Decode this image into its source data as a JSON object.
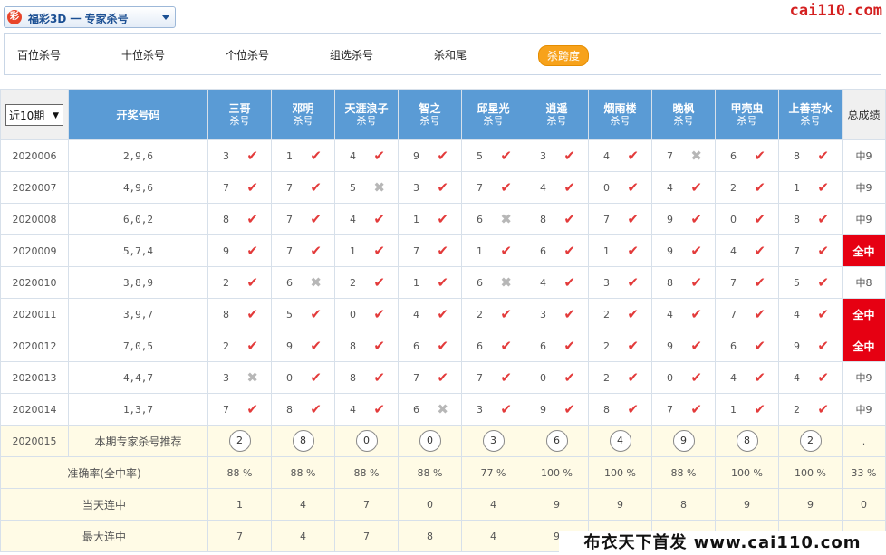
{
  "selector": {
    "logo": "彩",
    "label": "福彩3D 一 专家杀号"
  },
  "site": "cai110.com",
  "tabs": [
    {
      "label": "百位杀号",
      "active": false
    },
    {
      "label": "十位杀号",
      "active": false
    },
    {
      "label": "个位杀号",
      "active": false
    },
    {
      "label": "组选杀号",
      "active": false
    },
    {
      "label": "杀和尾",
      "active": false
    },
    {
      "label": "杀跨度",
      "active": true
    }
  ],
  "table": {
    "filter": "近10期",
    "draw_header": "开奖号码",
    "sub_header": "杀号",
    "score_header": "总成绩",
    "experts": [
      "三哥",
      "邓明",
      "天涯浪子",
      "智之",
      "邱星光",
      "逍遥",
      "烟雨楼",
      "晚枫",
      "甲壳虫",
      "上善若水"
    ],
    "rows": [
      {
        "period": "2020006",
        "draw": "2,9,6",
        "cells": [
          [
            "3",
            true
          ],
          [
            "1",
            true
          ],
          [
            "4",
            true
          ],
          [
            "9",
            true
          ],
          [
            "5",
            true
          ],
          [
            "3",
            true
          ],
          [
            "4",
            true
          ],
          [
            "7",
            false
          ],
          [
            "6",
            true
          ],
          [
            "8",
            true
          ]
        ],
        "score": "中9",
        "full": false
      },
      {
        "period": "2020007",
        "draw": "4,9,6",
        "cells": [
          [
            "7",
            true
          ],
          [
            "7",
            true
          ],
          [
            "5",
            false
          ],
          [
            "3",
            true
          ],
          [
            "7",
            true
          ],
          [
            "4",
            true
          ],
          [
            "0",
            true
          ],
          [
            "4",
            true
          ],
          [
            "2",
            true
          ],
          [
            "1",
            true
          ]
        ],
        "score": "中9",
        "full": false
      },
      {
        "period": "2020008",
        "draw": "6,0,2",
        "cells": [
          [
            "8",
            true
          ],
          [
            "7",
            true
          ],
          [
            "4",
            true
          ],
          [
            "1",
            true
          ],
          [
            "6",
            false
          ],
          [
            "8",
            true
          ],
          [
            "7",
            true
          ],
          [
            "9",
            true
          ],
          [
            "0",
            true
          ],
          [
            "8",
            true
          ]
        ],
        "score": "中9",
        "full": false
      },
      {
        "period": "2020009",
        "draw": "5,7,4",
        "cells": [
          [
            "9",
            true
          ],
          [
            "7",
            true
          ],
          [
            "1",
            true
          ],
          [
            "7",
            true
          ],
          [
            "1",
            true
          ],
          [
            "6",
            true
          ],
          [
            "1",
            true
          ],
          [
            "9",
            true
          ],
          [
            "4",
            true
          ],
          [
            "7",
            true
          ]
        ],
        "score": "全中",
        "full": true
      },
      {
        "period": "2020010",
        "draw": "3,8,9",
        "cells": [
          [
            "2",
            true
          ],
          [
            "6",
            false
          ],
          [
            "2",
            true
          ],
          [
            "1",
            true
          ],
          [
            "6",
            false
          ],
          [
            "4",
            true
          ],
          [
            "3",
            true
          ],
          [
            "8",
            true
          ],
          [
            "7",
            true
          ],
          [
            "5",
            true
          ]
        ],
        "score": "中8",
        "full": false
      },
      {
        "period": "2020011",
        "draw": "3,9,7",
        "cells": [
          [
            "8",
            true
          ],
          [
            "5",
            true
          ],
          [
            "0",
            true
          ],
          [
            "4",
            true
          ],
          [
            "2",
            true
          ],
          [
            "3",
            true
          ],
          [
            "2",
            true
          ],
          [
            "4",
            true
          ],
          [
            "7",
            true
          ],
          [
            "4",
            true
          ]
        ],
        "score": "全中",
        "full": true
      },
      {
        "period": "2020012",
        "draw": "7,0,5",
        "cells": [
          [
            "2",
            true
          ],
          [
            "9",
            true
          ],
          [
            "8",
            true
          ],
          [
            "6",
            true
          ],
          [
            "6",
            true
          ],
          [
            "6",
            true
          ],
          [
            "2",
            true
          ],
          [
            "9",
            true
          ],
          [
            "6",
            true
          ],
          [
            "9",
            true
          ]
        ],
        "score": "全中",
        "full": true
      },
      {
        "period": "2020013",
        "draw": "4,4,7",
        "cells": [
          [
            "3",
            false
          ],
          [
            "0",
            true
          ],
          [
            "8",
            true
          ],
          [
            "7",
            true
          ],
          [
            "7",
            true
          ],
          [
            "0",
            true
          ],
          [
            "2",
            true
          ],
          [
            "0",
            true
          ],
          [
            "4",
            true
          ],
          [
            "4",
            true
          ]
        ],
        "score": "中9",
        "full": false
      },
      {
        "period": "2020014",
        "draw": "1,3,7",
        "cells": [
          [
            "7",
            true
          ],
          [
            "8",
            true
          ],
          [
            "4",
            true
          ],
          [
            "6",
            false
          ],
          [
            "3",
            true
          ],
          [
            "9",
            true
          ],
          [
            "8",
            true
          ],
          [
            "7",
            true
          ],
          [
            "1",
            true
          ],
          [
            "2",
            true
          ]
        ],
        "score": "中9",
        "full": false
      }
    ],
    "recommend": {
      "period": "2020015",
      "label": "本期专家杀号推荐",
      "numbers": [
        "2",
        "8",
        "0",
        "0",
        "3",
        "6",
        "4",
        "9",
        "8",
        "2"
      ],
      "score": "."
    },
    "stats": [
      {
        "label": "准确率(全中率)",
        "values": [
          "88 %",
          "88 %",
          "88 %",
          "88 %",
          "77 %",
          "100 %",
          "100 %",
          "88 %",
          "100 %",
          "100 %"
        ],
        "total": "33 %"
      },
      {
        "label": "当天连中",
        "values": [
          "1",
          "4",
          "7",
          "0",
          "4",
          "9",
          "9",
          "8",
          "9",
          "9"
        ],
        "total": "0"
      },
      {
        "label": "最大连中",
        "values": [
          "7",
          "4",
          "7",
          "8",
          "4",
          "9",
          "",
          "",
          "",
          "",
          ""
        ],
        "total": ""
      }
    ]
  },
  "footer": "布衣天下首发 www.cai110.com"
}
